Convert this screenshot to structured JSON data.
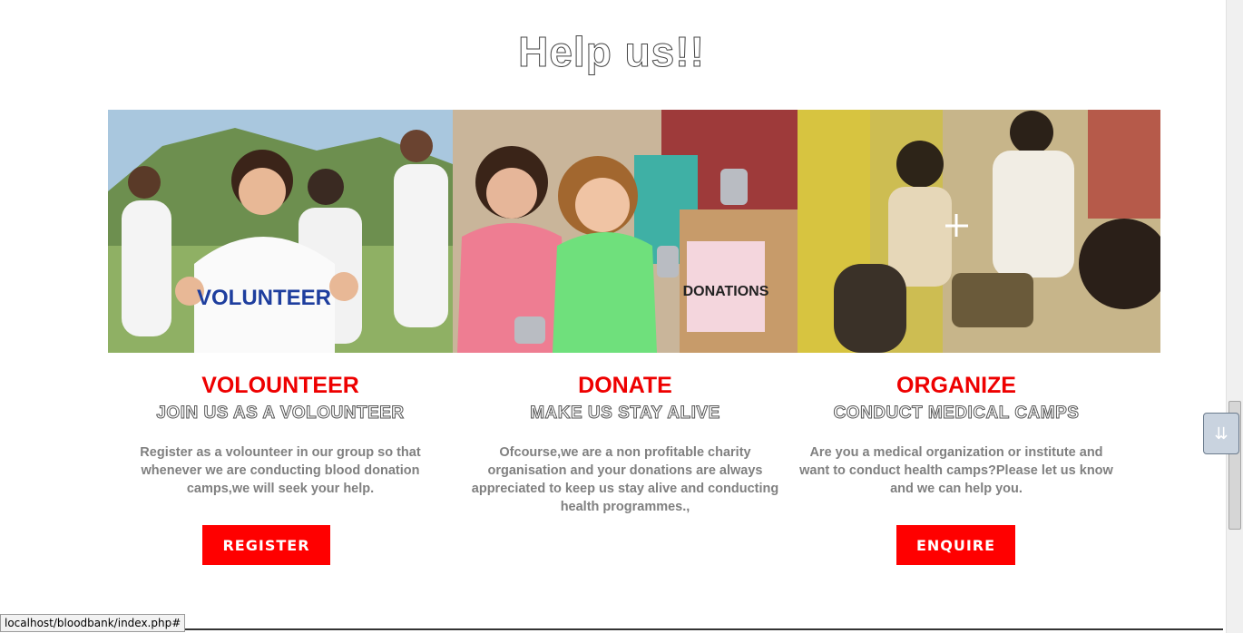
{
  "page": {
    "title": "Help us!!"
  },
  "cards": [
    {
      "heading": "VOLOUNTEER",
      "subheading": "JOIN US AS A VOLOUNTEER",
      "description": "Register as a volounteer in our group so that whenever we are conducting blood donation camps,we will seek your help.",
      "button": "REGISTER",
      "photo_text": "VOLUNTEER"
    },
    {
      "heading": "DONATE",
      "subheading": "MAKE US STAY ALIVE",
      "description": "Ofcourse,we are a non profitable charity organisation and your donations are always appreciated to keep us stay alive and conducting health programmes.,",
      "photo_text": "DONATIONS"
    },
    {
      "heading": "ORGANIZE",
      "subheading": "CONDUCT MEDICAL CAMPS",
      "description": "Are you a medical organization or institute and want to conduct health camps?Please let us know and we can help you.",
      "button": "ENQUIRE"
    }
  ],
  "status_bar": {
    "url": "localhost/bloodbank/index.php#"
  },
  "colors": {
    "accent": "#ff0000",
    "heading": "#ee0000",
    "body_text": "#808080"
  }
}
